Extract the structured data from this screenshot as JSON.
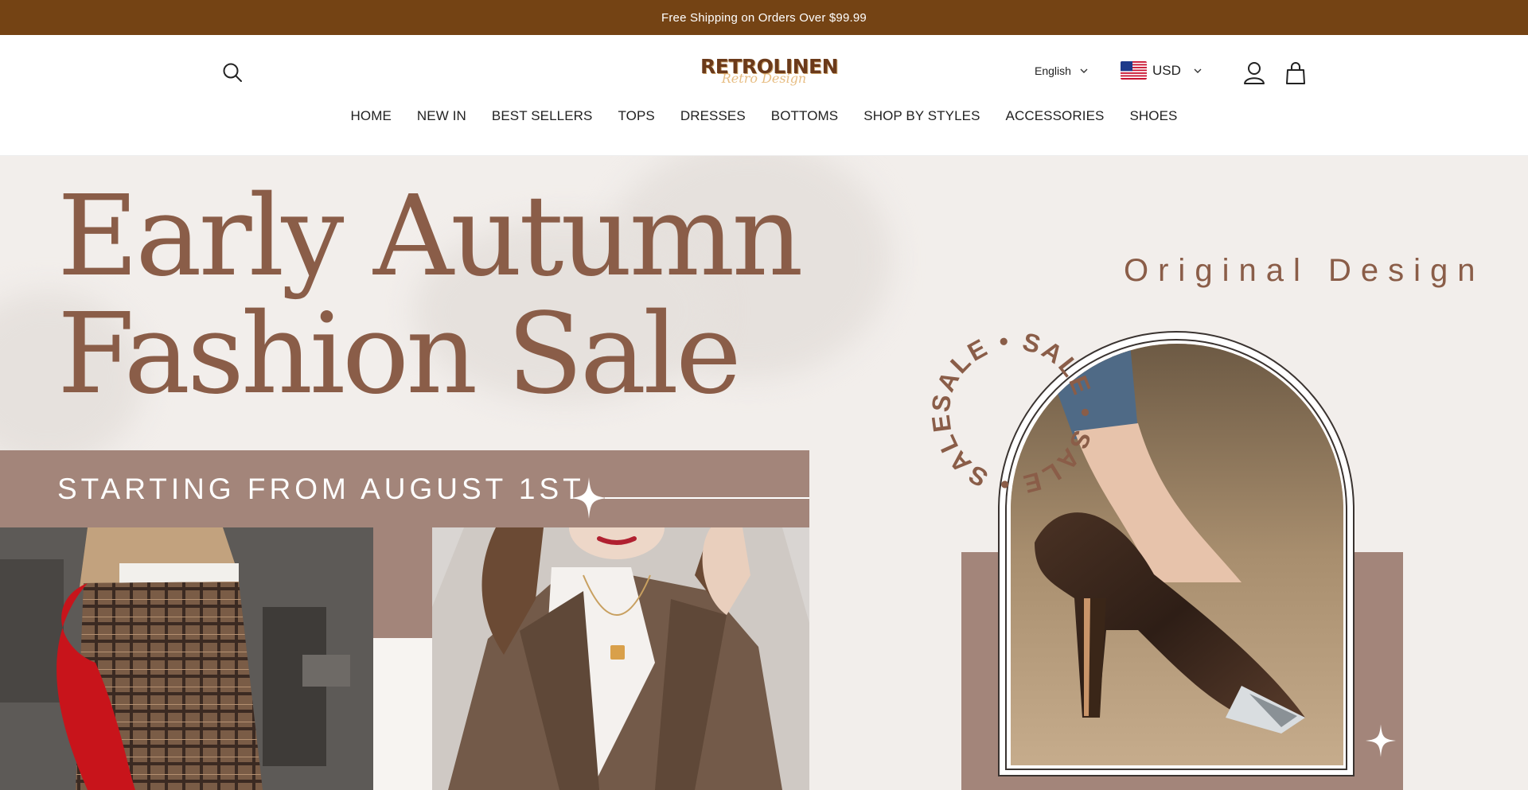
{
  "announcement": {
    "text": "Free Shipping on Orders Over $99.99"
  },
  "header": {
    "logo_main": "RETROLINEN",
    "logo_sub": "Retro Design",
    "language": "English",
    "currency": "USD"
  },
  "nav": {
    "items": [
      {
        "label": "HOME"
      },
      {
        "label": "NEW IN"
      },
      {
        "label": "BEST SELLERS"
      },
      {
        "label": "TOPS"
      },
      {
        "label": "DRESSES"
      },
      {
        "label": "BOTTOMS"
      },
      {
        "label": "SHOP BY STYLES"
      },
      {
        "label": "ACCESSORIES"
      },
      {
        "label": "SHOES"
      }
    ]
  },
  "hero": {
    "headline_line1": "Early Autumn",
    "headline_line2": "Fashion Sale",
    "subline": "STARTING FROM AUGUST 1ST",
    "tagline": "Original Design",
    "sale_ring_text": "SALE • SALE • SALE • SALE •"
  },
  "colors": {
    "announcement_bg": "#744314",
    "accent_brown": "#8a5d48",
    "band_mauve": "#a3857a",
    "hero_bg": "#f2eeeb"
  },
  "icons": {
    "search": "search-icon",
    "account": "user-icon",
    "cart": "shopping-bag-icon",
    "chevron": "chevron-down-icon",
    "flag": "us-flag-icon",
    "sparkle": "sparkle-icon"
  }
}
